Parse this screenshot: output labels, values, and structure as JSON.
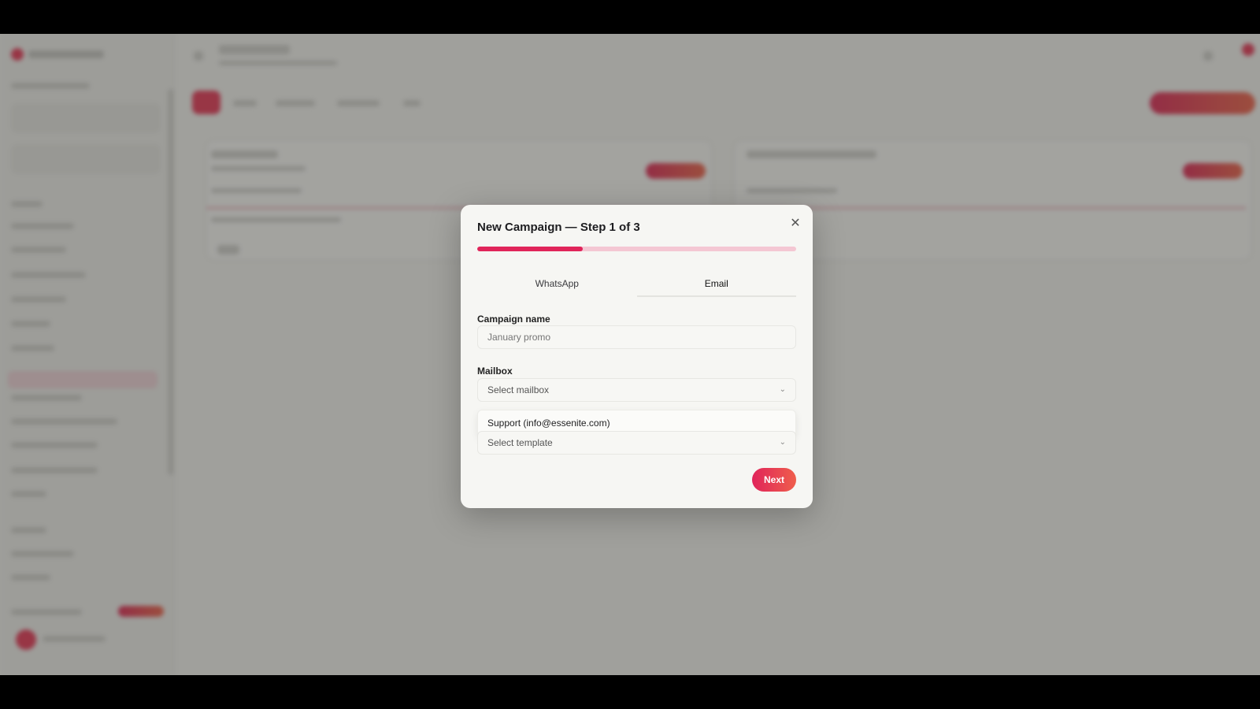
{
  "modal": {
    "title": "New Campaign — Step 1 of 3",
    "close_icon": "close-icon",
    "progress": 0.33,
    "tabs": [
      {
        "label": "WhatsApp",
        "active": false
      },
      {
        "label": "Email",
        "active": true
      }
    ],
    "campaign_name": {
      "label": "Campaign name",
      "placeholder": "January promo",
      "value": ""
    },
    "mailbox": {
      "label": "Mailbox",
      "placeholder": "Select mailbox",
      "options": [
        "Support (info@essenite.com)"
      ]
    },
    "template": {
      "placeholder": "Select template"
    },
    "next_label": "Next"
  },
  "colors": {
    "accent": "#e0245a",
    "accent_secondary": "#ef5e4c",
    "progress_track": "#f4c7d3"
  }
}
